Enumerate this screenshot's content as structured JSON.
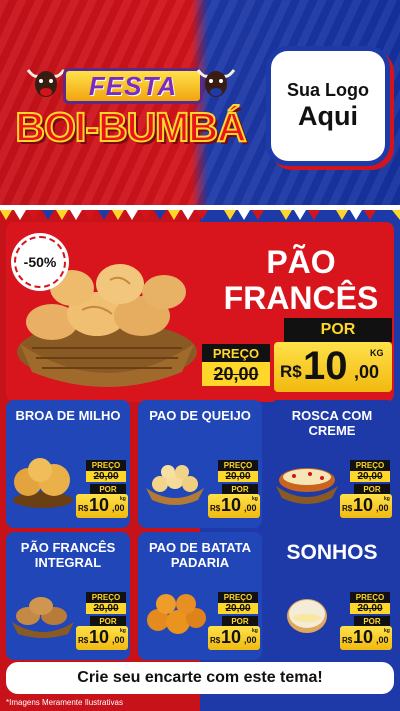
{
  "header": {
    "festa_label": "FESTA",
    "boi_label": "BOI-BUMBÁ",
    "logo_line1": "Sua Logo",
    "logo_line2": "Aqui"
  },
  "hero": {
    "discount": "-50%",
    "title_line1": "PÃO",
    "title_line2": "FRANCÊS",
    "preco_label": "PREÇO",
    "old_price": "20,00",
    "por_label": "POR",
    "currency": "R$",
    "new_price_int": "10",
    "new_price_dec": ",00",
    "unit": "KG"
  },
  "products": [
    {
      "name": "BROA DE MILHO",
      "preco_label": "PREÇO",
      "old_price": "20,00",
      "por_label": "POR",
      "currency": "R$",
      "new_price_int": "10",
      "new_price_dec": ",00",
      "unit": "kg"
    },
    {
      "name": "PAO DE QUEIJO",
      "preco_label": "PREÇO",
      "old_price": "20,00",
      "por_label": "POR",
      "currency": "R$",
      "new_price_int": "10",
      "new_price_dec": ",00",
      "unit": "kg"
    },
    {
      "name": "ROSCA COM CREME",
      "preco_label": "PREÇO",
      "old_price": "20,00",
      "por_label": "POR",
      "currency": "R$",
      "new_price_int": "10",
      "new_price_dec": ",00",
      "unit": "kg"
    },
    {
      "name": "PÃO FRANCÊS INTEGRAL",
      "preco_label": "PREÇO",
      "old_price": "20,00",
      "por_label": "POR",
      "currency": "R$",
      "new_price_int": "10",
      "new_price_dec": ",00",
      "unit": "kg"
    },
    {
      "name": "PAO DE BATATA PADARIA",
      "preco_label": "PREÇO",
      "old_price": "20,00",
      "por_label": "POR",
      "currency": "R$",
      "new_price_int": "10",
      "new_price_dec": ",00",
      "unit": "kg"
    },
    {
      "name": "SONHOS",
      "preco_label": "PREÇO",
      "old_price": "20,00",
      "por_label": "POR",
      "currency": "R$",
      "new_price_int": "10",
      "new_price_dec": ",00",
      "unit": "kg"
    }
  ],
  "cta": {
    "label": "Crie seu encarte com este tema!"
  },
  "disclaimer": "*Imagens Meramente Ilustrativas",
  "colors": {
    "red": "#d8141c",
    "blue": "#2046b8",
    "yellow": "#ffd62a",
    "black": "#111111"
  }
}
